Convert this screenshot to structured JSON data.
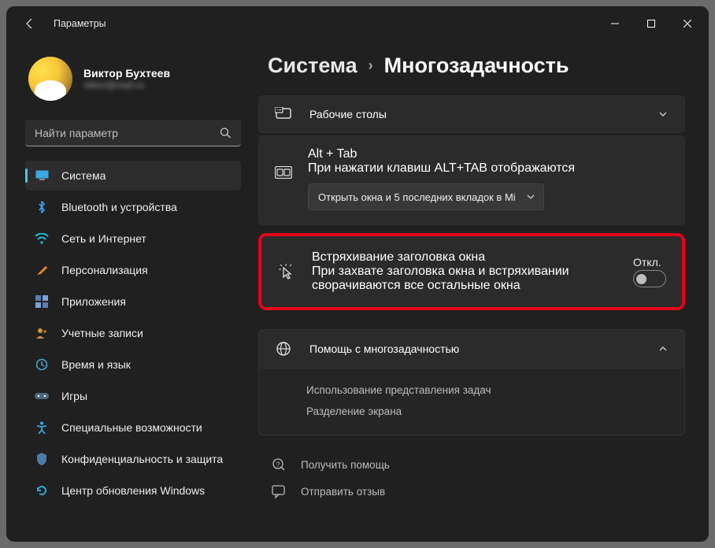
{
  "titlebar": {
    "title": "Параметры"
  },
  "profile": {
    "name": "Виктор Бухтеев",
    "email": "viktor@mail.ru"
  },
  "search": {
    "placeholder": "Найти параметр"
  },
  "sidebar": {
    "items": [
      {
        "label": "Система",
        "icon": "monitor"
      },
      {
        "label": "Bluetooth и устройства",
        "icon": "bluetooth"
      },
      {
        "label": "Сеть и Интернет",
        "icon": "wifi"
      },
      {
        "label": "Персонализация",
        "icon": "brush"
      },
      {
        "label": "Приложения",
        "icon": "apps"
      },
      {
        "label": "Учетные записи",
        "icon": "accounts"
      },
      {
        "label": "Время и язык",
        "icon": "clock"
      },
      {
        "label": "Игры",
        "icon": "games"
      },
      {
        "label": "Специальные возможности",
        "icon": "accessibility"
      },
      {
        "label": "Конфиденциальность и защита",
        "icon": "privacy"
      },
      {
        "label": "Центр обновления Windows",
        "icon": "update"
      }
    ]
  },
  "breadcrumb": {
    "parent": "Система",
    "current": "Многозадачность"
  },
  "cards": {
    "desktops": {
      "title": "Рабочие столы"
    },
    "alttab": {
      "title": "Alt + Tab",
      "desc": "При нажатии клавиш ALT+TAB отображаются",
      "dropdown": "Открыть окна и 5 последних вкладок в Mi"
    },
    "shake": {
      "title": "Встряхивание заголовка окна",
      "desc": "При захвате заголовка окна и встряхивании сворачиваются все остальные окна",
      "state": "Откл."
    },
    "help": {
      "title": "Помощь с многозадачностью",
      "links": [
        "Использование представления задач",
        "Разделение экрана"
      ]
    }
  },
  "footer": {
    "get_help": "Получить помощь",
    "feedback": "Отправить отзыв"
  }
}
